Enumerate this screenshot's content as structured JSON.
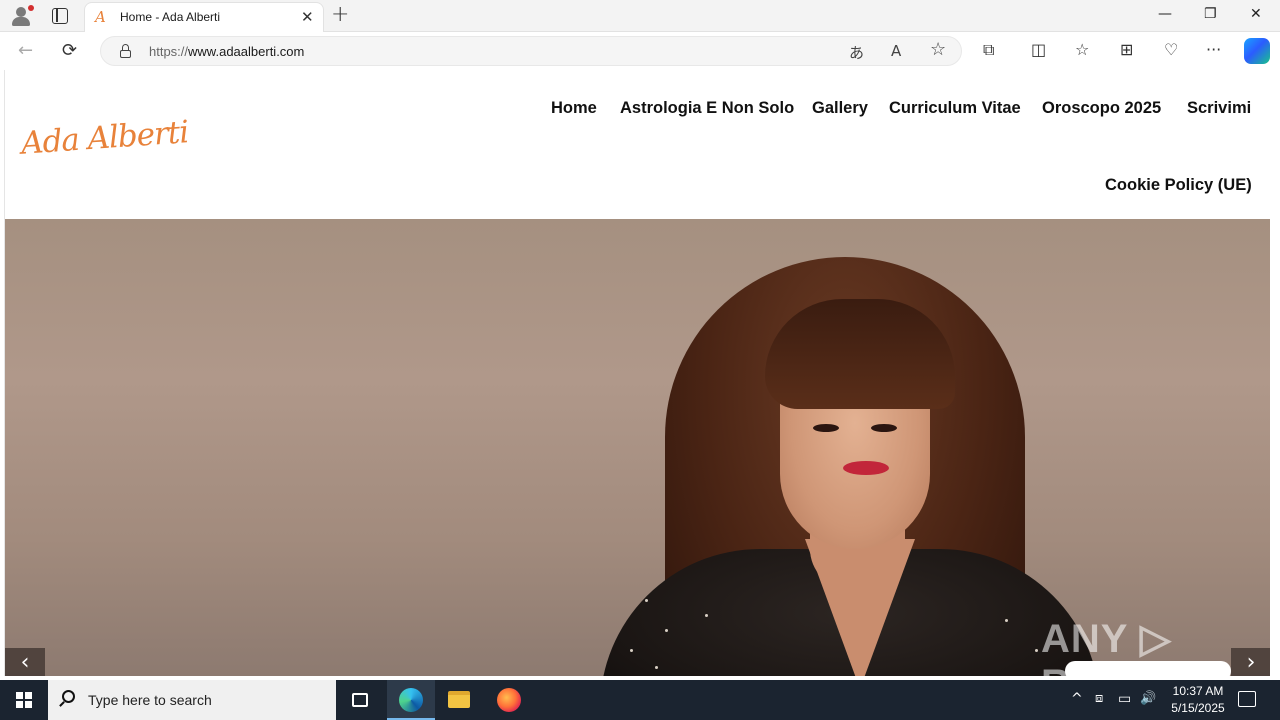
{
  "browser": {
    "tab_title": "Home - Ada Alberti",
    "tab_favicon": "A",
    "new_tab": "+",
    "tab_close": "✕",
    "url_scheme": "https://",
    "url_host": "www.adaalberti.com",
    "window_controls": {
      "minimize": "—",
      "restore": "❐",
      "close": "✕"
    },
    "toolbar": {
      "back": "←",
      "reload": "⟳",
      "translate": "あ",
      "read_aloud": "A",
      "favorite": "☆",
      "extensions": "⧉",
      "split_screen": "◫",
      "favorites": "☆",
      "collections": "⊞",
      "browser_essentials": "♡",
      "more": "···"
    }
  },
  "site": {
    "logo": "Ada Alberti",
    "menu": [
      "Home",
      "Astrologia E Non Solo",
      "Gallery",
      "Curriculum Vitae",
      "Oroscopo 2025",
      "Scrivimi",
      "Cookie Policy (UE)"
    ],
    "slider": {
      "prev": "‹",
      "next": "›"
    },
    "watermark": "ANY ▷ RUN"
  },
  "taskbar": {
    "search_placeholder": "Type here to search",
    "tray": {
      "chevron": "^",
      "network": "▭",
      "volume": "🔊"
    },
    "time": "10:37 AM",
    "date": "5/15/2025"
  },
  "colors": {
    "accent": "#e8823a",
    "taskbar": "#1b2430"
  }
}
